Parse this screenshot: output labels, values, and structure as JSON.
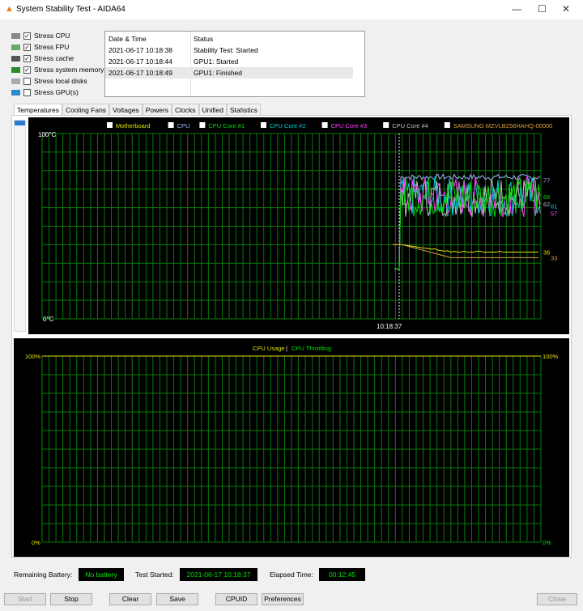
{
  "window": {
    "title": "System Stability Test - AIDA64"
  },
  "stress_options": [
    {
      "label": "Stress CPU",
      "checked": true,
      "icon": "cpu-icon"
    },
    {
      "label": "Stress FPU",
      "checked": true,
      "icon": "fpu-icon"
    },
    {
      "label": "Stress cache",
      "checked": true,
      "icon": "cache-icon"
    },
    {
      "label": "Stress system memory",
      "checked": true,
      "icon": "memory-icon"
    },
    {
      "label": "Stress local disks",
      "checked": false,
      "icon": "disk-icon"
    },
    {
      "label": "Stress GPU(s)",
      "checked": false,
      "icon": "gpu-icon"
    }
  ],
  "log": {
    "headers": [
      "Date & Time",
      "Status"
    ],
    "rows": [
      [
        "2021-06-17 10:18:38",
        "Stability Test: Started"
      ],
      [
        "2021-06-17 10:18:44",
        "GPU1: Started"
      ],
      [
        "2021-06-17 10:18:49",
        "GPU1: Finished"
      ]
    ]
  },
  "tabs": [
    "Temperatures",
    "Cooling Fans",
    "Voltages",
    "Powers",
    "Clocks",
    "Unified",
    "Statistics"
  ],
  "temp_graph": {
    "y_top": "100°C",
    "y_bottom": "0°C",
    "x_label": "10:18:37",
    "legend": [
      {
        "label": "Motherboard",
        "color": "#e0e000"
      },
      {
        "label": "CPU",
        "color": "#a0b8ff"
      },
      {
        "label": "CPU Core #1",
        "color": "#00e000"
      },
      {
        "label": "CPU Core #2",
        "color": "#00d0e0"
      },
      {
        "label": "CPU Core #3",
        "color": "#ff40ff"
      },
      {
        "label": "CPU Core #4",
        "color": "#c0c0c0"
      },
      {
        "label": "SAMSUNG MZVLB256HAHQ-00000",
        "color": "#e0a040"
      }
    ],
    "end_values": [
      {
        "value": "77",
        "color": "#a0b8ff",
        "series": 1
      },
      {
        "value": "66",
        "color": "#00e000",
        "series": 2
      },
      {
        "value": "62",
        "color": "#c0c0c0",
        "series": 5
      },
      {
        "value": "61",
        "color": "#00d0e0",
        "series": 3
      },
      {
        "value": "57",
        "color": "#ff40ff",
        "series": 4
      },
      {
        "value": "36",
        "color": "#e0e000",
        "series": 0
      },
      {
        "value": "33",
        "color": "#e0a040",
        "series": 6
      }
    ]
  },
  "usage_graph": {
    "legend_a": "CPU Usage",
    "sep": "|",
    "legend_b": "CPU Throttling",
    "color_a": "#e0e000",
    "color_b": "#00e000",
    "y_top_left": "100%",
    "y_bottom_left": "0%",
    "y_top_right": "100%",
    "y_bottom_right": "0%"
  },
  "status": {
    "battery_label": "Remaining Battery:",
    "battery": "No battery",
    "started_label": "Test Started:",
    "started": "2021-06-17 10:18:37",
    "elapsed_label": "Elapsed Time:",
    "elapsed": "00:12:45"
  },
  "buttons": {
    "start": "Start",
    "stop": "Stop",
    "clear": "Clear",
    "save": "Save",
    "cpuid": "CPUID",
    "preferences": "Preferences",
    "close": "Close"
  }
}
